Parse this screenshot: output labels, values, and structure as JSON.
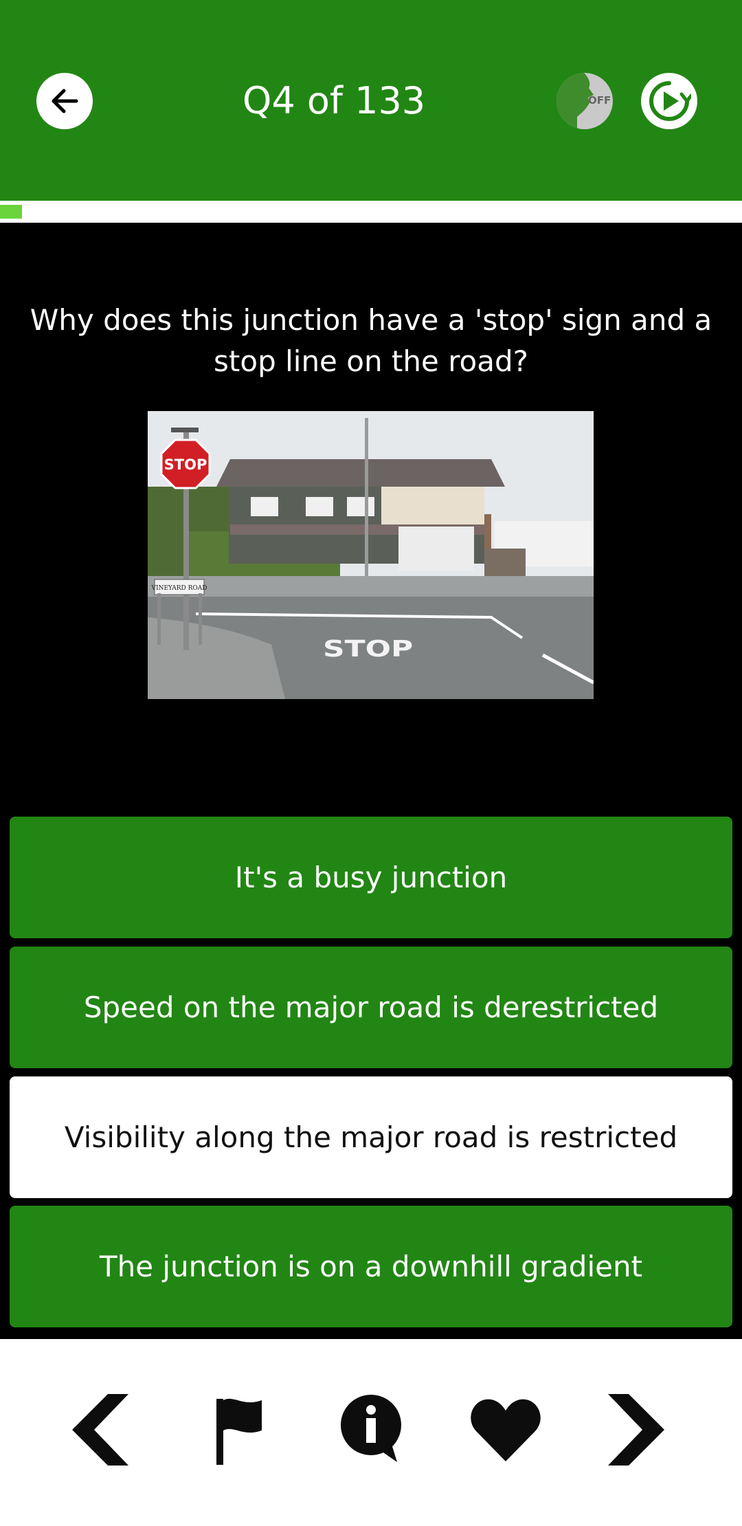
{
  "header": {
    "title": "Q4 of 133",
    "voice_toggle_state": "OFF",
    "back_icon": "arrow-left-icon",
    "voice_icon": "speaking-head-icon",
    "replay_icon": "replay-icon",
    "color": "#228614"
  },
  "progress": {
    "current": 4,
    "total": 133,
    "fraction": 0.03,
    "color": "#6ad43a"
  },
  "question": {
    "text": "Why does this junction have a 'stop' sign and a stop line on the road?",
    "image_sign_text": "STOP",
    "image_road_text": "STOP",
    "image_street_name": "VINEYARD ROAD"
  },
  "answers": [
    {
      "text": "It's a busy junction",
      "selected": false
    },
    {
      "text": "Speed on the major road is derestricted",
      "selected": false
    },
    {
      "text": "Visibility along the major road is restricted",
      "selected": true
    },
    {
      "text": "The junction is on a downhill gradient",
      "selected": false
    }
  ],
  "bottom_nav": {
    "items": [
      "chevron-left-icon",
      "flag-icon",
      "info-bubble-icon",
      "heart-icon",
      "chevron-right-icon"
    ]
  }
}
